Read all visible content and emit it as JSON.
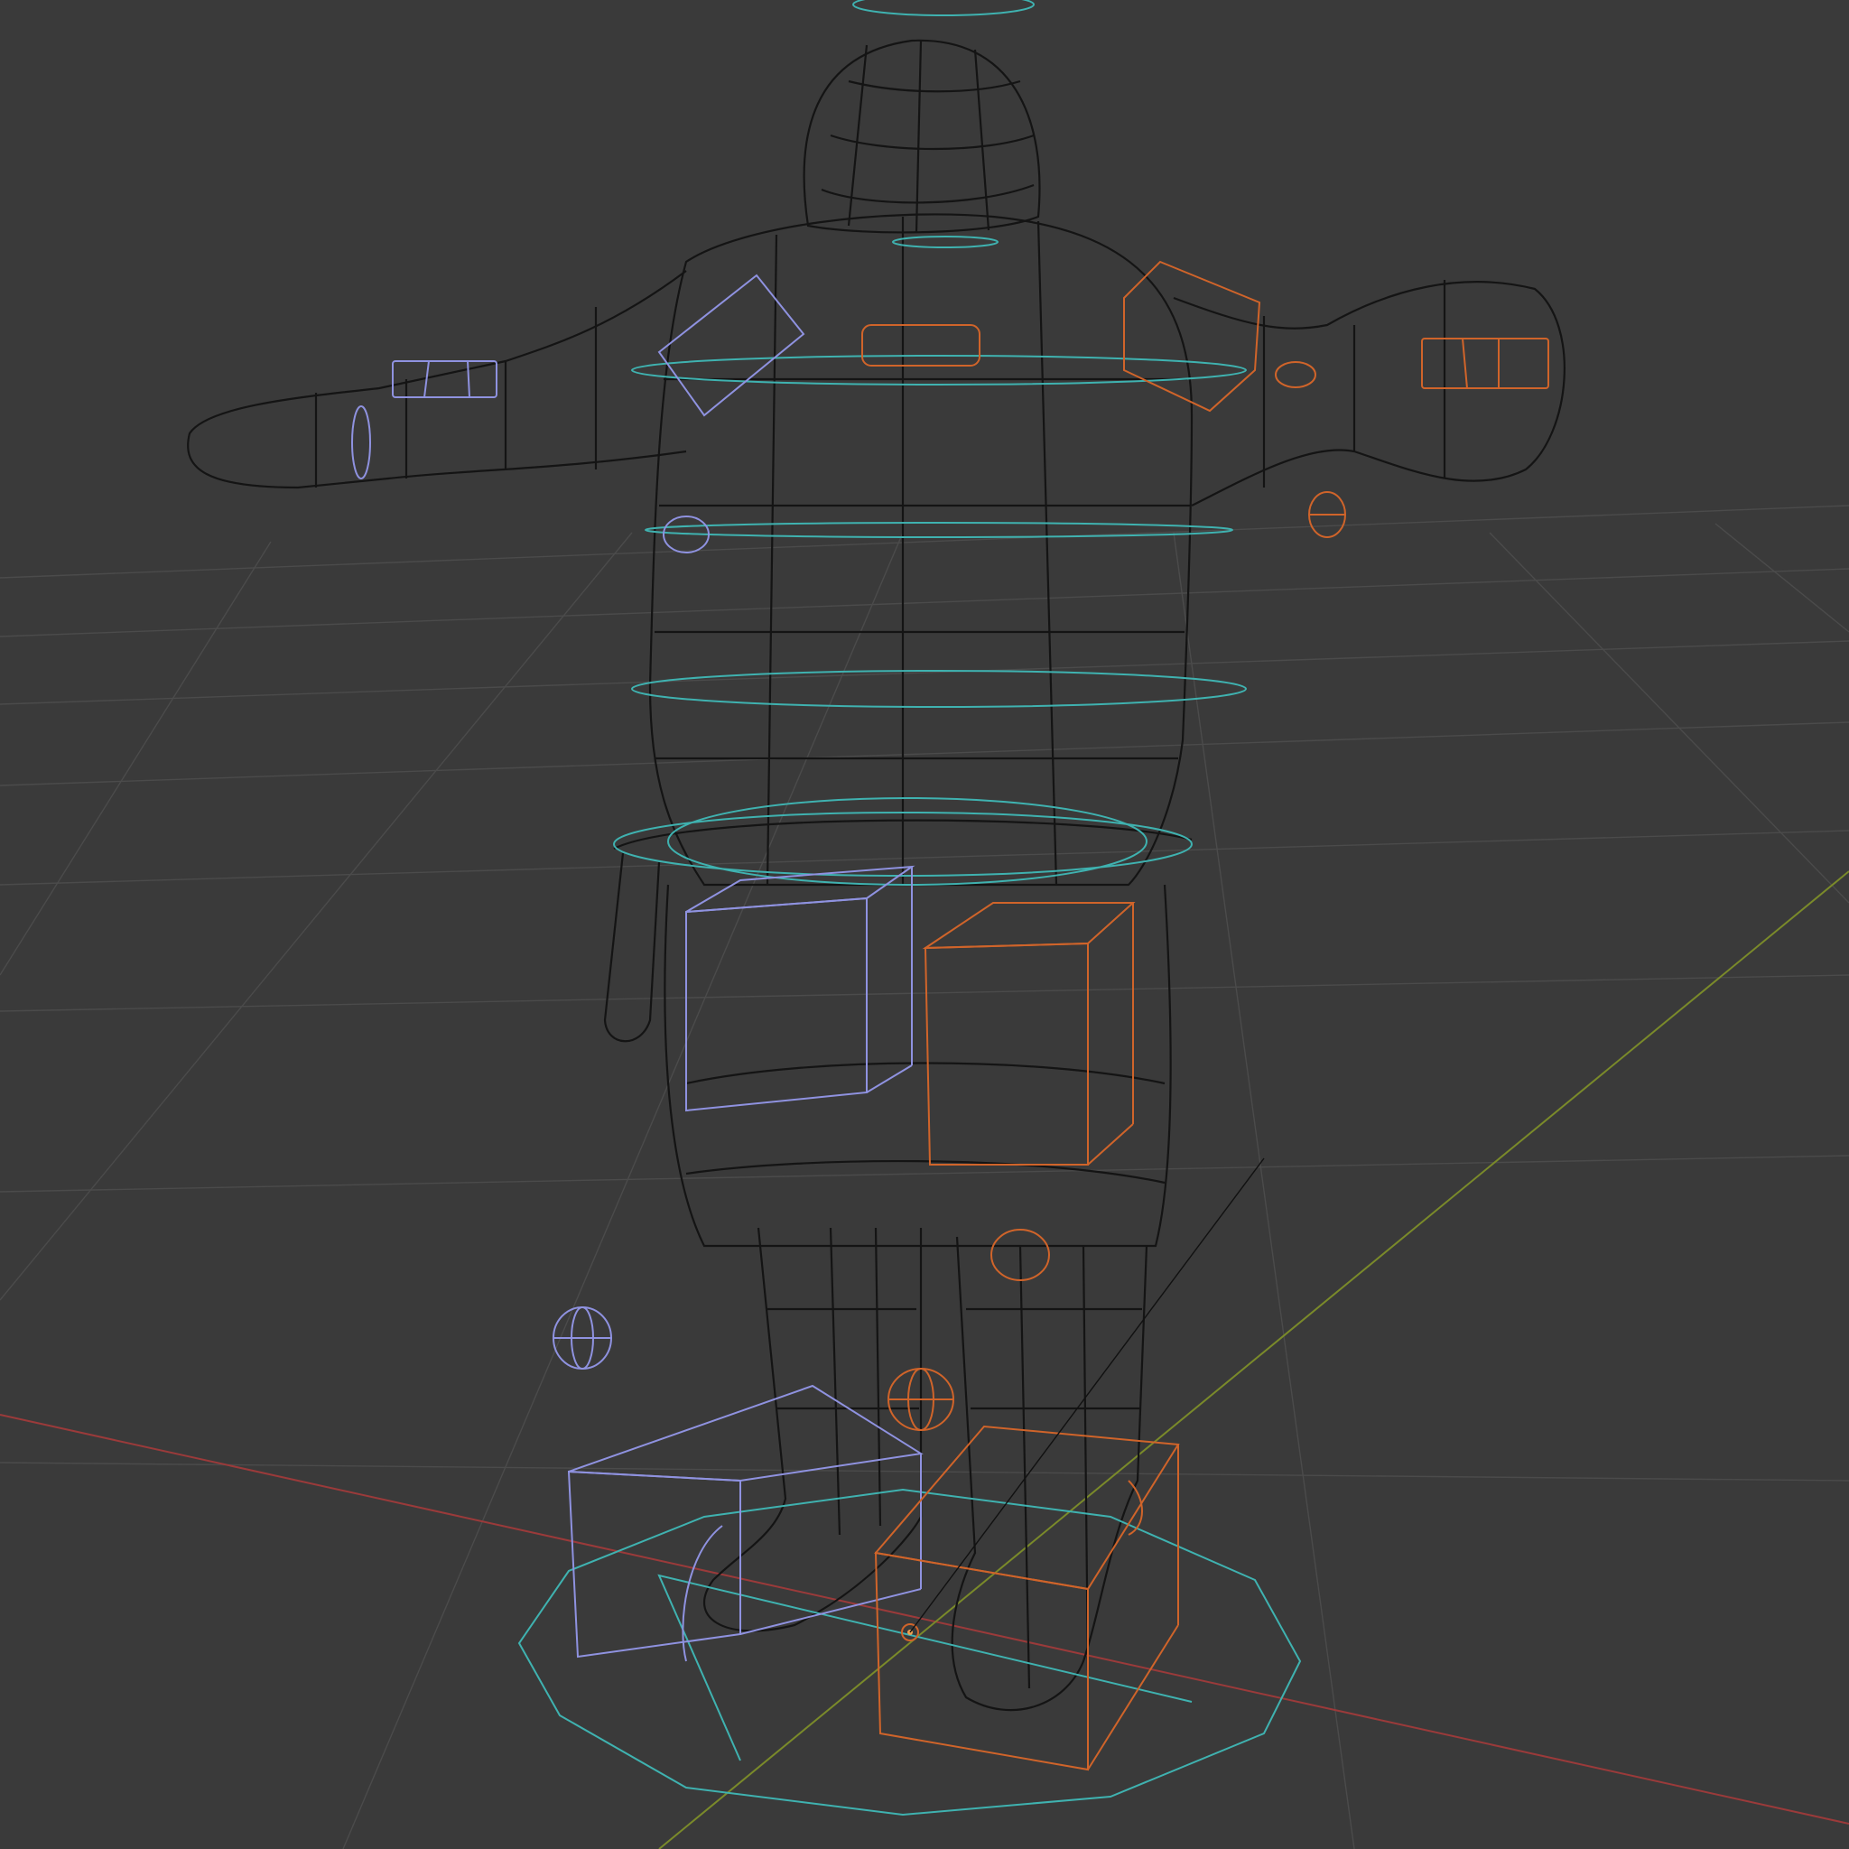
{
  "viewport": {
    "mode": "wireframe",
    "background_color": "#3a3a3a",
    "grid_line_color": "#4a4a4a",
    "grid": true
  },
  "axes": {
    "x_axis_color": "#9b3a3a",
    "y_axis_color": "#7a8a2a"
  },
  "rig": {
    "mesh_wire_color": "#101010",
    "control_colors": {
      "center": "#3fb2b0",
      "left": "#8f92e0",
      "right": "#d0642a"
    }
  },
  "objects": [
    {
      "name": "character-mesh",
      "visible": true
    },
    {
      "name": "root-control",
      "visible": true
    },
    {
      "name": "spine-controls",
      "visible": true
    },
    {
      "name": "left-leg-ik-control",
      "visible": true
    },
    {
      "name": "right-leg-ik-control",
      "visible": true
    },
    {
      "name": "left-arm-controls",
      "visible": true
    },
    {
      "name": "right-arm-controls",
      "visible": true
    },
    {
      "name": "head-control",
      "visible": true
    },
    {
      "name": "knee-pole-targets",
      "visible": true
    },
    {
      "name": "origin-point",
      "visible": true
    }
  ]
}
